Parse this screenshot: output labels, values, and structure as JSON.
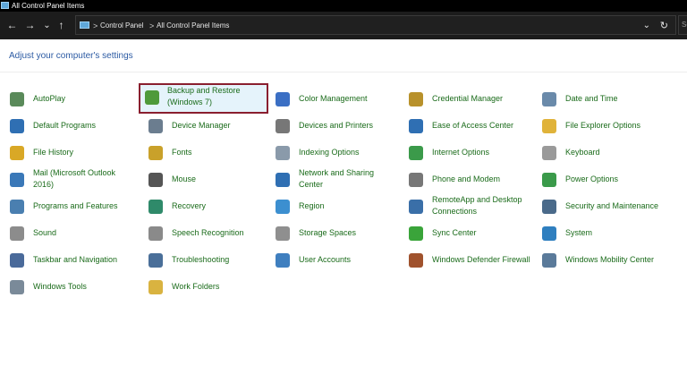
{
  "window": {
    "title": "All Control Panel Items"
  },
  "nav": {
    "back": "←",
    "forward": "→",
    "recent": "⌄",
    "up": "↑"
  },
  "address": {
    "crumbs": [
      "Control Panel",
      "All Control Panel Items"
    ],
    "separator": ">",
    "dropdown": "⌄",
    "refresh": "↻"
  },
  "search": {
    "placeholder": "Se"
  },
  "heading": "Adjust your computer's settings",
  "columns": [
    [
      "AutoPlay",
      "Default Programs",
      "File History",
      "Mail (Microsoft Outlook 2016)",
      "Programs and Features",
      "Sound",
      "Taskbar and Navigation",
      "Windows Tools"
    ],
    [
      "Backup and Restore (Windows 7)",
      "Device Manager",
      "Fonts",
      "Mouse",
      "Recovery",
      "Speech Recognition",
      "Troubleshooting",
      "Work Folders"
    ],
    [
      "Color Management",
      "Devices and Printers",
      "Indexing Options",
      "Network and Sharing Center",
      "Region",
      "Storage Spaces",
      "User Accounts"
    ],
    [
      "Credential Manager",
      "Ease of Access Center",
      "Internet Options",
      "Phone and Modem",
      "RemoteApp and Desktop Connections",
      "Sync Center",
      "Windows Defender Firewall"
    ],
    [
      "Date and Time",
      "File Explorer Options",
      "Keyboard",
      "Power Options",
      "Security and Maintenance",
      "System",
      "Windows Mobility Center"
    ]
  ],
  "icon_names": [
    [
      "autoplay-icon",
      "default-programs-icon",
      "file-history-icon",
      "mail-icon",
      "programs-features-icon",
      "sound-icon",
      "taskbar-icon",
      "windows-tools-icon"
    ],
    [
      "backup-restore-icon",
      "device-manager-icon",
      "fonts-icon",
      "mouse-icon",
      "recovery-icon",
      "speech-recognition-icon",
      "troubleshooting-icon",
      "work-folders-icon"
    ],
    [
      "color-management-icon",
      "devices-printers-icon",
      "indexing-options-icon",
      "network-sharing-icon",
      "region-icon",
      "storage-spaces-icon",
      "user-accounts-icon"
    ],
    [
      "credential-manager-icon",
      "ease-of-access-icon",
      "internet-options-icon",
      "phone-modem-icon",
      "remoteapp-icon",
      "sync-center-icon",
      "firewall-icon"
    ],
    [
      "date-time-icon",
      "file-explorer-options-icon",
      "keyboard-icon",
      "power-options-icon",
      "security-maintenance-icon",
      "system-icon",
      "mobility-center-icon"
    ]
  ],
  "icon_colors": [
    [
      "#5a8a5a",
      "#2f6fb3",
      "#d9a826",
      "#3a78b8",
      "#4a7fb0",
      "#8c8c8c",
      "#4a6a9a",
      "#7a8a99"
    ],
    [
      "#4f9a3a",
      "#6b7d8f",
      "#c9a12a",
      "#555555",
      "#2f8a6a",
      "#8a8a8a",
      "#4a6f99",
      "#d9b340"
    ],
    [
      "#3b6fc4",
      "#777777",
      "#8a9aaa",
      "#2f6fb3",
      "#3c8fd0",
      "#8f8f8f",
      "#3f7fbf"
    ],
    [
      "#b8912b",
      "#2f6fb3",
      "#3b9a4a",
      "#777777",
      "#3a6fa8",
      "#3aa43a",
      "#a0522d"
    ],
    [
      "#6a8aaa",
      "#e0b33a",
      "#9a9a9a",
      "#3a9a4a",
      "#4a6a8a",
      "#2f7fbf",
      "#5a7a9a"
    ]
  ],
  "selected_item": "Backup and Restore (Windows 7)",
  "colors": {
    "link": "#1a6b1a",
    "heading": "#2b5aa3",
    "selection_border": "#8a1f2f",
    "selection_fill": "#e5f3fb"
  }
}
